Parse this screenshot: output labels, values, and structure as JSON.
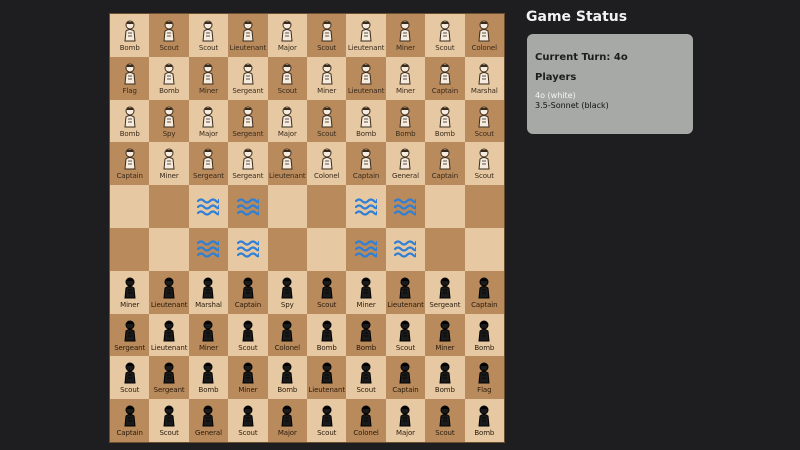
{
  "status": {
    "title": "Game Status",
    "current_turn_text": "Current Turn: 4o",
    "players_heading": "Players",
    "players": [
      {
        "text": "4o (white)",
        "side": "white"
      },
      {
        "text": "3.5-Sonnet (black)",
        "side": "black"
      }
    ]
  },
  "colors": {
    "light_square": "#e6c9a3",
    "dark_square": "#b88a5c",
    "water": "#2f7fd6",
    "panel": "#a7a9a6"
  },
  "board": {
    "rows": [
      [
        {
          "label": "Bomb",
          "side": "white"
        },
        {
          "label": "Scout",
          "side": "white"
        },
        {
          "label": "Scout",
          "side": "white"
        },
        {
          "label": "Lieutenant",
          "side": "white"
        },
        {
          "label": "Major",
          "side": "white"
        },
        {
          "label": "Scout",
          "side": "white"
        },
        {
          "label": "Lieutenant",
          "side": "white"
        },
        {
          "label": "Miner",
          "side": "white"
        },
        {
          "label": "Scout",
          "side": "white"
        },
        {
          "label": "Colonel",
          "side": "white"
        }
      ],
      [
        {
          "label": "Flag",
          "side": "white"
        },
        {
          "label": "Bomb",
          "side": "white"
        },
        {
          "label": "Miner",
          "side": "white"
        },
        {
          "label": "Sergeant",
          "side": "white"
        },
        {
          "label": "Scout",
          "side": "white"
        },
        {
          "label": "Miner",
          "side": "white"
        },
        {
          "label": "Lieutenant",
          "side": "white"
        },
        {
          "label": "Miner",
          "side": "white"
        },
        {
          "label": "Captain",
          "side": "white"
        },
        {
          "label": "Marshal",
          "side": "white"
        }
      ],
      [
        {
          "label": "Bomb",
          "side": "white"
        },
        {
          "label": "Spy",
          "side": "white"
        },
        {
          "label": "Major",
          "side": "white"
        },
        {
          "label": "Sergeant",
          "side": "white"
        },
        {
          "label": "Major",
          "side": "white"
        },
        {
          "label": "Scout",
          "side": "white"
        },
        {
          "label": "Bomb",
          "side": "white"
        },
        {
          "label": "Bomb",
          "side": "white"
        },
        {
          "label": "Bomb",
          "side": "white"
        },
        {
          "label": "Scout",
          "side": "white"
        }
      ],
      [
        {
          "label": "Captain",
          "side": "white"
        },
        {
          "label": "Miner",
          "side": "white"
        },
        {
          "label": "Sergeant",
          "side": "white"
        },
        {
          "label": "Sergeant",
          "side": "white"
        },
        {
          "label": "Lieutenant",
          "side": "white"
        },
        {
          "label": "Colonel",
          "side": "white"
        },
        {
          "label": "Captain",
          "side": "white"
        },
        {
          "label": "General",
          "side": "white"
        },
        {
          "label": "Captain",
          "side": "white"
        },
        {
          "label": "Scout",
          "side": "white"
        }
      ],
      [
        {
          "label": "",
          "side": "empty"
        },
        {
          "label": "",
          "side": "empty"
        },
        {
          "label": "",
          "side": "water"
        },
        {
          "label": "",
          "side": "water"
        },
        {
          "label": "",
          "side": "empty"
        },
        {
          "label": "",
          "side": "empty"
        },
        {
          "label": "",
          "side": "water"
        },
        {
          "label": "",
          "side": "water"
        },
        {
          "label": "",
          "side": "empty"
        },
        {
          "label": "",
          "side": "empty"
        }
      ],
      [
        {
          "label": "",
          "side": "empty"
        },
        {
          "label": "",
          "side": "empty"
        },
        {
          "label": "",
          "side": "water"
        },
        {
          "label": "",
          "side": "water"
        },
        {
          "label": "",
          "side": "empty"
        },
        {
          "label": "",
          "side": "empty"
        },
        {
          "label": "",
          "side": "water"
        },
        {
          "label": "",
          "side": "water"
        },
        {
          "label": "",
          "side": "empty"
        },
        {
          "label": "",
          "side": "empty"
        }
      ],
      [
        {
          "label": "Miner",
          "side": "black"
        },
        {
          "label": "Lieutenant",
          "side": "black"
        },
        {
          "label": "Marshal",
          "side": "black"
        },
        {
          "label": "Captain",
          "side": "black"
        },
        {
          "label": "Spy",
          "side": "black"
        },
        {
          "label": "Scout",
          "side": "black"
        },
        {
          "label": "Miner",
          "side": "black"
        },
        {
          "label": "Lieutenant",
          "side": "black"
        },
        {
          "label": "Sergeant",
          "side": "black"
        },
        {
          "label": "Captain",
          "side": "black"
        }
      ],
      [
        {
          "label": "Sergeant",
          "side": "black"
        },
        {
          "label": "Lieutenant",
          "side": "black"
        },
        {
          "label": "Miner",
          "side": "black"
        },
        {
          "label": "Scout",
          "side": "black"
        },
        {
          "label": "Colonel",
          "side": "black"
        },
        {
          "label": "Bomb",
          "side": "black"
        },
        {
          "label": "Bomb",
          "side": "black"
        },
        {
          "label": "Scout",
          "side": "black"
        },
        {
          "label": "Miner",
          "side": "black"
        },
        {
          "label": "Bomb",
          "side": "black"
        }
      ],
      [
        {
          "label": "Scout",
          "side": "black"
        },
        {
          "label": "Sergeant",
          "side": "black"
        },
        {
          "label": "Bomb",
          "side": "black"
        },
        {
          "label": "Miner",
          "side": "black"
        },
        {
          "label": "Bomb",
          "side": "black"
        },
        {
          "label": "Lieutenant",
          "side": "black"
        },
        {
          "label": "Scout",
          "side": "black"
        },
        {
          "label": "Captain",
          "side": "black"
        },
        {
          "label": "Bomb",
          "side": "black"
        },
        {
          "label": "Flag",
          "side": "black"
        }
      ],
      [
        {
          "label": "Captain",
          "side": "black"
        },
        {
          "label": "Scout",
          "side": "black"
        },
        {
          "label": "General",
          "side": "black"
        },
        {
          "label": "Scout",
          "side": "black"
        },
        {
          "label": "Major",
          "side": "black"
        },
        {
          "label": "Scout",
          "side": "black"
        },
        {
          "label": "Colonel",
          "side": "black"
        },
        {
          "label": "Major",
          "side": "black"
        },
        {
          "label": "Scout",
          "side": "black"
        },
        {
          "label": "Bomb",
          "side": "black"
        }
      ]
    ]
  }
}
